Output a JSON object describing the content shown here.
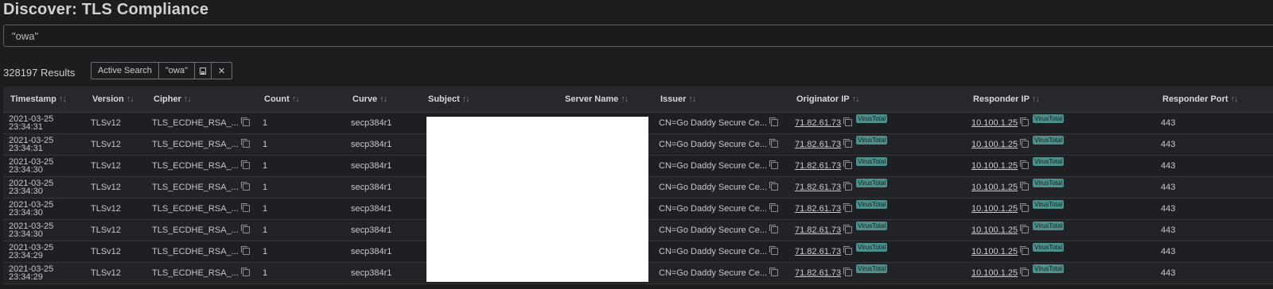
{
  "page": {
    "title": "Discover: TLS Compliance"
  },
  "search": {
    "value": "\"owa\""
  },
  "results": {
    "count_label": "328197 Results"
  },
  "filter_bar": {
    "active_search_label": "Active Search",
    "query_chip": "\"owa\"",
    "save_icon": "save-icon",
    "close_symbol": "✕"
  },
  "table": {
    "sort_glyph": "↑↓",
    "columns": [
      "Timestamp",
      "Version",
      "Cipher",
      "Count",
      "Curve",
      "Subject",
      "Server Name",
      "Issuer",
      "Originator IP",
      "Responder IP",
      "Responder Port"
    ],
    "virustotal_label": "VirusTotal",
    "rows": [
      {
        "date": "2021-03-25",
        "time": "23:34:31",
        "version": "TLSv12",
        "cipher": "TLS_ECDHE_RSA_...",
        "count": "1",
        "curve": "secp384r1",
        "issuer": "CN=Go Daddy Secure Ce...",
        "orig_ip": "71.82.61.73",
        "resp_ip": "10.100.1.25",
        "resp_port": "443"
      },
      {
        "date": "2021-03-25",
        "time": "23:34:31",
        "version": "TLSv12",
        "cipher": "TLS_ECDHE_RSA_...",
        "count": "1",
        "curve": "secp384r1",
        "issuer": "CN=Go Daddy Secure Ce...",
        "orig_ip": "71.82.61.73",
        "resp_ip": "10.100.1.25",
        "resp_port": "443"
      },
      {
        "date": "2021-03-25",
        "time": "23:34:30",
        "version": "TLSv12",
        "cipher": "TLS_ECDHE_RSA_...",
        "count": "1",
        "curve": "secp384r1",
        "issuer": "CN=Go Daddy Secure Ce...",
        "orig_ip": "71.82.61.73",
        "resp_ip": "10.100.1.25",
        "resp_port": "443"
      },
      {
        "date": "2021-03-25",
        "time": "23:34:30",
        "version": "TLSv12",
        "cipher": "TLS_ECDHE_RSA_...",
        "count": "1",
        "curve": "secp384r1",
        "issuer": "CN=Go Daddy Secure Ce...",
        "orig_ip": "71.82.61.73",
        "resp_ip": "10.100.1.25",
        "resp_port": "443"
      },
      {
        "date": "2021-03-25",
        "time": "23:34:30",
        "version": "TLSv12",
        "cipher": "TLS_ECDHE_RSA_...",
        "count": "1",
        "curve": "secp384r1",
        "issuer": "CN=Go Daddy Secure Ce...",
        "orig_ip": "71.82.61.73",
        "resp_ip": "10.100.1.25",
        "resp_port": "443"
      },
      {
        "date": "2021-03-25",
        "time": "23:34:30",
        "version": "TLSv12",
        "cipher": "TLS_ECDHE_RSA_...",
        "count": "1",
        "curve": "secp384r1",
        "issuer": "CN=Go Daddy Secure Ce...",
        "orig_ip": "71.82.61.73",
        "resp_ip": "10.100.1.25",
        "resp_port": "443"
      },
      {
        "date": "2021-03-25",
        "time": "23:34:29",
        "version": "TLSv12",
        "cipher": "TLS_ECDHE_RSA_...",
        "count": "1",
        "curve": "secp384r1",
        "issuer": "CN=Go Daddy Secure Ce...",
        "orig_ip": "71.82.61.73",
        "resp_ip": "10.100.1.25",
        "resp_port": "443"
      },
      {
        "date": "2021-03-25",
        "time": "23:34:29",
        "version": "TLSv12",
        "cipher": "TLS_ECDHE_RSA_...",
        "count": "1",
        "curve": "secp384r1",
        "issuer": "CN=Go Daddy Secure Ce...",
        "orig_ip": "71.82.61.73",
        "resp_ip": "10.100.1.25",
        "resp_port": "443"
      }
    ]
  },
  "colors": {
    "background": "#1c1d1f",
    "header_bg": "#26282c",
    "virustotal_badge": "#4f8f8b",
    "redaction": "#ffffff"
  }
}
